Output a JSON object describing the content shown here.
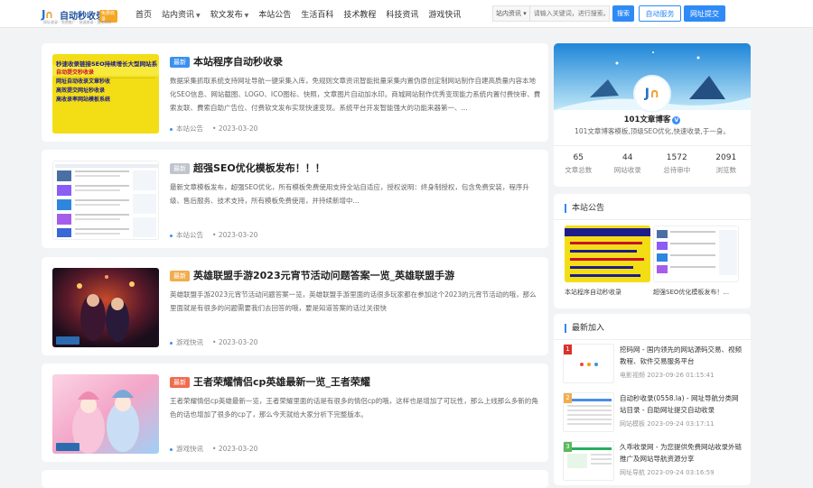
{
  "header": {
    "logo_text": "自动秒收录",
    "logo_badge": "免费收录",
    "logo_sub": "网址收录 · 免费推广 · 快速收录 · 提交网址",
    "nav": [
      {
        "label": "首页",
        "caret": false
      },
      {
        "label": "站内资讯",
        "caret": true
      },
      {
        "label": "软文发布",
        "caret": true
      },
      {
        "label": "本站公告",
        "caret": false
      },
      {
        "label": "生活百科",
        "caret": false
      },
      {
        "label": "技术教程",
        "caret": false
      },
      {
        "label": "科技资讯",
        "caret": false
      },
      {
        "label": "游戏快讯",
        "caret": false
      }
    ],
    "search_select": "站内资讯 ▾",
    "search_placeholder": "请输入关键词，进行搜索。",
    "search_button": "搜索",
    "auto_service": "自动服务",
    "submit_site": "网址提交"
  },
  "posts": [
    {
      "tag": "最新",
      "tag_color": "#3b8ff0",
      "title": "本站程序自动秒收录",
      "desc": "数据采集抓取系统支持网址导航一键采集入库，免规则文章资讯智能批量采集内置伪原创定制网站制作自建高质量内容本地化SEO信息、网站截图、LOGO、ICO图标、快照，文章图片自动加水印。商城网站制作优秀变现能力系统内置付费快审、費索友联、費索自助广告位、付费软文发布实现快速变现。系统平台开发智能强大的功能来器第一、...",
      "category": "本站公告",
      "date": "2023-03-20"
    },
    {
      "tag": "最新",
      "tag_color": "#c0c4cc",
      "title": "超强SEO优化模板发布！！！",
      "desc": "最新文章模板发布，超强SEO优化，所有模板免费使用支持全站自适应，授权说明：终身制授权，包含免费安装，程序升级、售后服务、技术支持，所有模板免费使用，并持续新增中...",
      "category": "本站公告",
      "date": "2023-03-20"
    },
    {
      "tag": "最新",
      "tag_color": "#f0ad4e",
      "title": "英雄联盟手游2023元宵节活动问题答案一览_英雄联盟手游",
      "desc": "英雄联盟手游2023元宵节活动问题答案一览，英雄联盟手游里面的话很多玩家都在参加这个2023的元宵节活动的哦，那么里面就是有很多的问题需要我们去回答的哦，要是知道答案的话过关很快",
      "category": "游戏快讯",
      "date": "2023-03-20"
    },
    {
      "tag": "最新",
      "tag_color": "#f06b4e",
      "title": "王者荣耀情侣cp英雄最新一览_王者荣耀",
      "desc": "王者荣耀情侣cp英雄最新一览，王者荣耀里面的话是有很多的情侣cp的哦，这样也是增加了可玩性，那么上线那么多新的角色的话也增加了很多的cp了，那么今天就给大家分析下完整版本。",
      "category": "游戏快讯",
      "date": "2023-03-20"
    }
  ],
  "profile": {
    "name": "101文章博客",
    "verified": "V",
    "desc": "101文章博客模板,顶级SEO优化,快速收录,于一身。",
    "stats": [
      {
        "n": "65",
        "l": "文章总数"
      },
      {
        "n": "44",
        "l": "网站收录"
      },
      {
        "n": "1572",
        "l": "总待审中"
      },
      {
        "n": "2091",
        "l": "浏览数"
      }
    ]
  },
  "notice": {
    "title": "本站公告",
    "items": [
      {
        "label": "本站程序自动秒收录"
      },
      {
        "label": "超强SEO优化模板发布！..."
      }
    ]
  },
  "latest": {
    "title": "最新加入",
    "items": [
      {
        "rank": "1",
        "rank_color": "#d9322b",
        "title": "挖码网 - 国内领先的网站源码交易、视频教程、软件交易服务平台",
        "meta": "电影视频 2023-09-26 01:15:41"
      },
      {
        "rank": "2",
        "rank_color": "#f0ad4e",
        "title": "自动秒收录(0558.la) - 网址导航分类网站目录 - 自助网址提交自动收录",
        "meta": "网站模板 2023-09-24 03:17:11"
      },
      {
        "rank": "3",
        "rank_color": "#5cb85c",
        "title": "久乖收录网 - 为您提供免费网站收录外链推广及网站导航资源分享",
        "meta": "网址导航 2023-09-24 03:16:59"
      }
    ]
  },
  "thumb_texts": {
    "post1_lines": [
      "秒速收录链接SEO持续增长大型网站系统",
      "自动提交秒收录",
      "网址自动收录文章秒收",
      "高效提交网址秒收录",
      "高收录率网站模板系统"
    ]
  }
}
